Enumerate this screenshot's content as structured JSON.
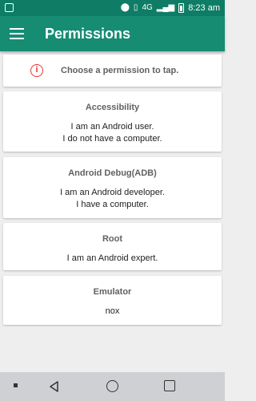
{
  "status_bar": {
    "time": "8:23 am",
    "icons": [
      "app-notification-icon",
      "location-icon",
      "vibrate-icon",
      "4g-icon",
      "signal-icon",
      "battery-icon"
    ],
    "network_label": "4G"
  },
  "app_bar": {
    "title": "Permissions",
    "menu_icon": "hamburger-menu-icon",
    "color": "#168c73"
  },
  "info": {
    "icon": "info-icon",
    "text": "Choose a permission to tap.",
    "icon_color": "#e53935"
  },
  "permissions": [
    {
      "title": "Accessibility",
      "description": "I am an Android user.\nI do not have a computer."
    },
    {
      "title": "Android Debug(ADB)",
      "description": "I am an Android developer.\nI have a computer."
    },
    {
      "title": "Root",
      "description": "I am an Android expert."
    },
    {
      "title": "Emulator",
      "description": "nox"
    }
  ],
  "nav_bar": {
    "buttons": [
      "back-icon",
      "home-icon",
      "recents-icon"
    ]
  }
}
